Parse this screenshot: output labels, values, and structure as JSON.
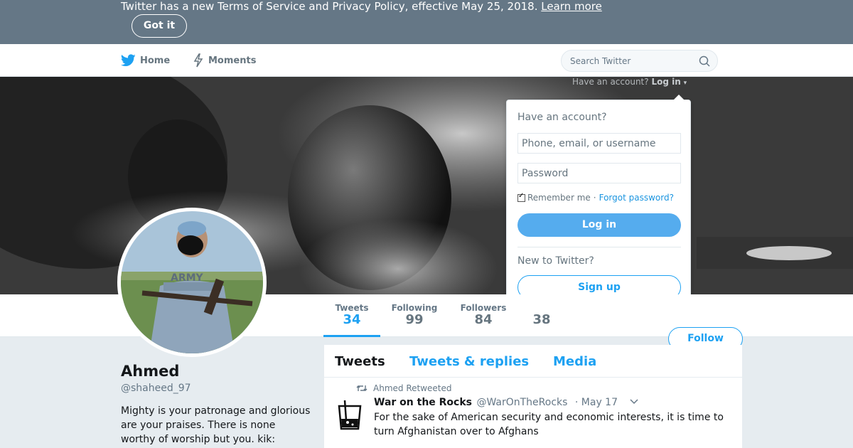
{
  "banner": {
    "text": "Twitter has a new Terms of Service and Privacy Policy, effective May 25, 2018.",
    "learn_more": "Learn more",
    "got_it": "Got it"
  },
  "nav": {
    "home": "Home",
    "moments": "Moments",
    "search_placeholder": "Search Twitter"
  },
  "header": {
    "have_account": "Have an account?",
    "log_in": "Log in"
  },
  "login_dropdown": {
    "title": "Have an account?",
    "username_placeholder": "Phone, email, or username",
    "password_placeholder": "Password",
    "remember_me": "Remember me",
    "separator": "·",
    "forgot_password": "Forgot password?",
    "login_button": "Log in",
    "new_to_twitter": "New to Twitter?",
    "signup_button": "Sign up"
  },
  "stats": [
    {
      "label": "Tweets",
      "value": "34"
    },
    {
      "label": "Following",
      "value": "99"
    },
    {
      "label": "Followers",
      "value": "84"
    },
    {
      "label": "",
      "value": "38"
    }
  ],
  "follow_button": "Follow",
  "profile": {
    "name": "Ahmed",
    "handle": "@shaheed_97",
    "bio": "Mighty is your patronage and glorious are your praises. There is none worthy of worship but you. kik:"
  },
  "timeline": {
    "tabs": [
      "Tweets",
      "Tweets & replies",
      "Media"
    ],
    "tweet": {
      "retweet_context": "Ahmed Retweeted",
      "author": "War on the Rocks",
      "handle": "@WarOnTheRocks",
      "time": "· May 17",
      "text": "For the sake of American security and economic interests, it is time to turn Afghanistan over to Afghans"
    }
  },
  "colors": {
    "brand_blue": "#1da1f2",
    "banner_bg": "#657786",
    "login_button": "#55acee"
  }
}
